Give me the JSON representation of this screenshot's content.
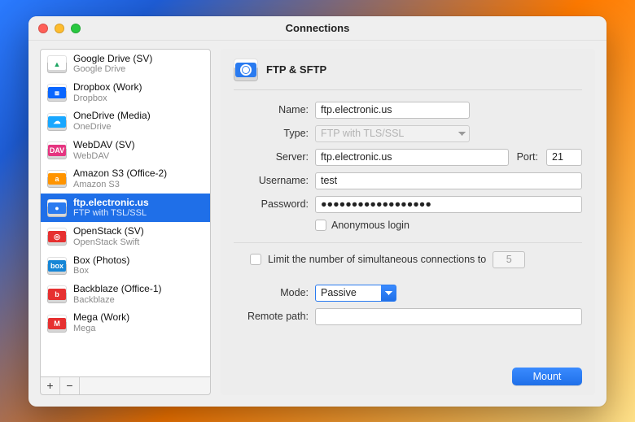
{
  "window": {
    "title": "Connections"
  },
  "sidebar": {
    "items": [
      {
        "title": "Google Drive (SV)",
        "subtitle": "Google Drive",
        "icon_name": "google-drive-icon",
        "icon_color": "#ffffff",
        "glyph": "▲",
        "glyph_color": "#1da462"
      },
      {
        "title": "Dropbox (Work)",
        "subtitle": "Dropbox",
        "icon_name": "dropbox-icon",
        "icon_color": "#0a66ff",
        "glyph": "⧈",
        "glyph_color": "#ffffff"
      },
      {
        "title": "OneDrive (Media)",
        "subtitle": "OneDrive",
        "icon_name": "onedrive-icon",
        "icon_color": "#19a7ff",
        "glyph": "☁",
        "glyph_color": "#ffffff"
      },
      {
        "title": "WebDAV (SV)",
        "subtitle": "WebDAV",
        "icon_name": "webdav-icon",
        "icon_color": "#e53580",
        "glyph": "DAV",
        "glyph_color": "#ffffff"
      },
      {
        "title": "Amazon S3 (Office-2)",
        "subtitle": "Amazon S3",
        "icon_name": "amazon-s3-icon",
        "icon_color": "#ff9400",
        "glyph": "a",
        "glyph_color": "#ffffff"
      },
      {
        "title": "ftp.electronic.us",
        "subtitle": "FTP with TSL/SSL",
        "icon_name": "ftp-icon",
        "icon_color": "#2a7bf0",
        "glyph": "●",
        "glyph_color": "#ffffff",
        "selected": true
      },
      {
        "title": "OpenStack (SV)",
        "subtitle": "OpenStack Swift",
        "icon_name": "openstack-icon",
        "icon_color": "#e63030",
        "glyph": "◎",
        "glyph_color": "#ffffff"
      },
      {
        "title": "Box (Photos)",
        "subtitle": "Box",
        "icon_name": "box-icon",
        "icon_color": "#1686d6",
        "glyph": "box",
        "glyph_color": "#ffffff"
      },
      {
        "title": "Backblaze (Office-1)",
        "subtitle": "Backblaze",
        "icon_name": "backblaze-icon",
        "icon_color": "#e63030",
        "glyph": "b",
        "glyph_color": "#ffffff"
      },
      {
        "title": "Mega (Work)",
        "subtitle": "Mega",
        "icon_name": "mega-icon",
        "icon_color": "#e63030",
        "glyph": "M",
        "glyph_color": "#ffffff"
      }
    ],
    "add_label": "+",
    "remove_label": "−"
  },
  "panel": {
    "title": "FTP & SFTP",
    "fields": {
      "name_label": "Name:",
      "name_value": "ftp.electronic.us",
      "type_label": "Type:",
      "type_value": "FTP with TLS/SSL",
      "server_label": "Server:",
      "server_value": "ftp.electronic.us",
      "port_label": "Port:",
      "port_value": "21",
      "username_label": "Username:",
      "username_value": "test",
      "password_label": "Password:",
      "password_value": "●●●●●●●●●●●●●●●●●●",
      "anonymous_label": "Anonymous login",
      "limit_label": "Limit the number of simultaneous connections to",
      "limit_value": "5",
      "mode_label": "Mode:",
      "mode_value": "Passive",
      "remote_label": "Remote path:",
      "remote_value": ""
    },
    "mount_label": "Mount"
  }
}
